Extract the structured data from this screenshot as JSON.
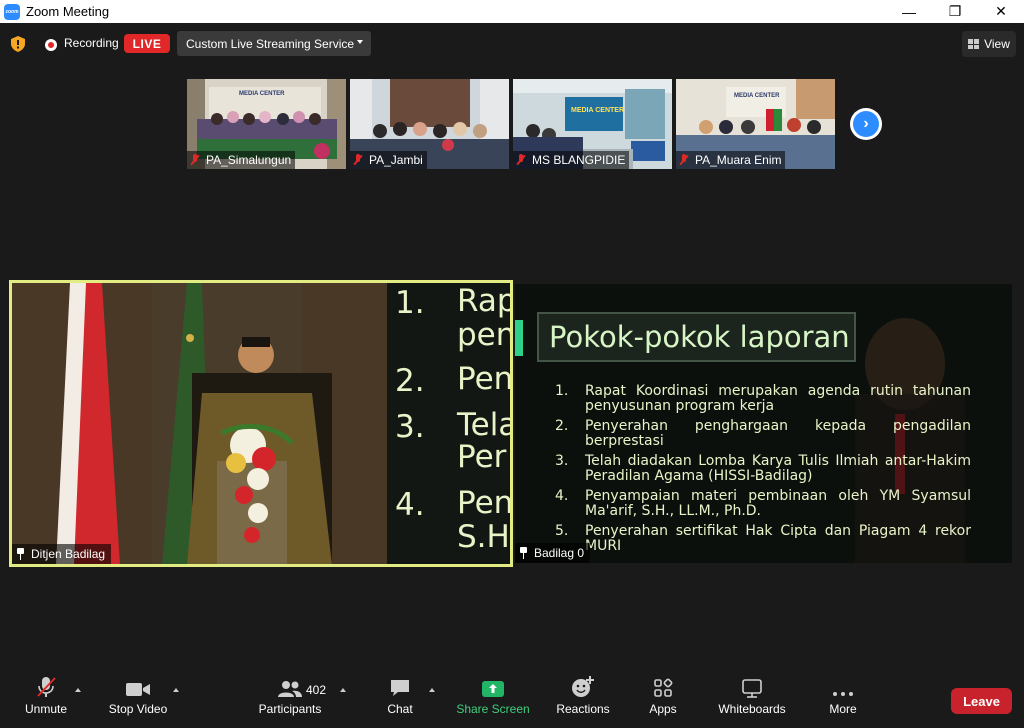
{
  "window": {
    "title": "Zoom Meeting",
    "app_icon": "zoom",
    "app_icon_text": "zoom",
    "minimize": "—",
    "maximize": "❐",
    "close": "✕"
  },
  "topbar": {
    "security_icon": "shield-icon",
    "recording_label": "Recording",
    "live_badge": "LIVE",
    "stream_service": "Custom Live Streaming Service",
    "view_label": "View"
  },
  "thumbnails": [
    {
      "name": "PA_Simalungun",
      "muted": true,
      "banner": "MEDIA CENTER"
    },
    {
      "name": "PA_Jambi",
      "muted": true
    },
    {
      "name": "MS BLANGPIDIE",
      "muted": true,
      "banner": "MEDIA CENTER"
    },
    {
      "name": "PA_Muara Enim",
      "muted": true,
      "banner": "MEDIA CENTER"
    }
  ],
  "main": {
    "left_tile": {
      "name": "Ditjen Badilag",
      "slide_numbers": [
        "1.",
        "2.",
        "3.",
        "4."
      ],
      "slide_fragments": [
        "Rap",
        "pen",
        "Pen",
        "Tela",
        "Per",
        "Pen",
        "S.H"
      ]
    },
    "right_tile": {
      "name": "Badilag 0",
      "slide_title": "Pokok-pokok laporan",
      "items": [
        {
          "num": "1.",
          "text": "Rapat Koordinasi merupakan agenda rutin tahunan penyusunan program kerja"
        },
        {
          "num": "2.",
          "text": "Penyerahan penghargaan kepada pengadilan berprestasi"
        },
        {
          "num": "3.",
          "text": "Telah diadakan Lomba Karya Tulis Ilmiah antar-Hakim Peradilan Agama (HISSI-Badilag)"
        },
        {
          "num": "4.",
          "text": "Penyampaian materi pembinaan oleh YM Syamsul Ma'arif, S.H., LL.M., Ph.D."
        },
        {
          "num": "5.",
          "text": "Penyerahan sertifikat Hak Cipta dan Piagam 4 rekor MURI"
        }
      ]
    }
  },
  "toolbar": {
    "unmute": "Unmute",
    "stop_video": "Stop Video",
    "participants": "Participants",
    "participant_count": "402",
    "chat": "Chat",
    "share_screen": "Share Screen",
    "reactions": "Reactions",
    "apps": "Apps",
    "whiteboards": "Whiteboards",
    "more": "More",
    "leave": "Leave"
  },
  "colors": {
    "accent_blue": "#2d8cff",
    "live_red": "#e02828",
    "share_green": "#3fd07d",
    "leave_red": "#c8232c",
    "active_border": "#e3ec83"
  }
}
